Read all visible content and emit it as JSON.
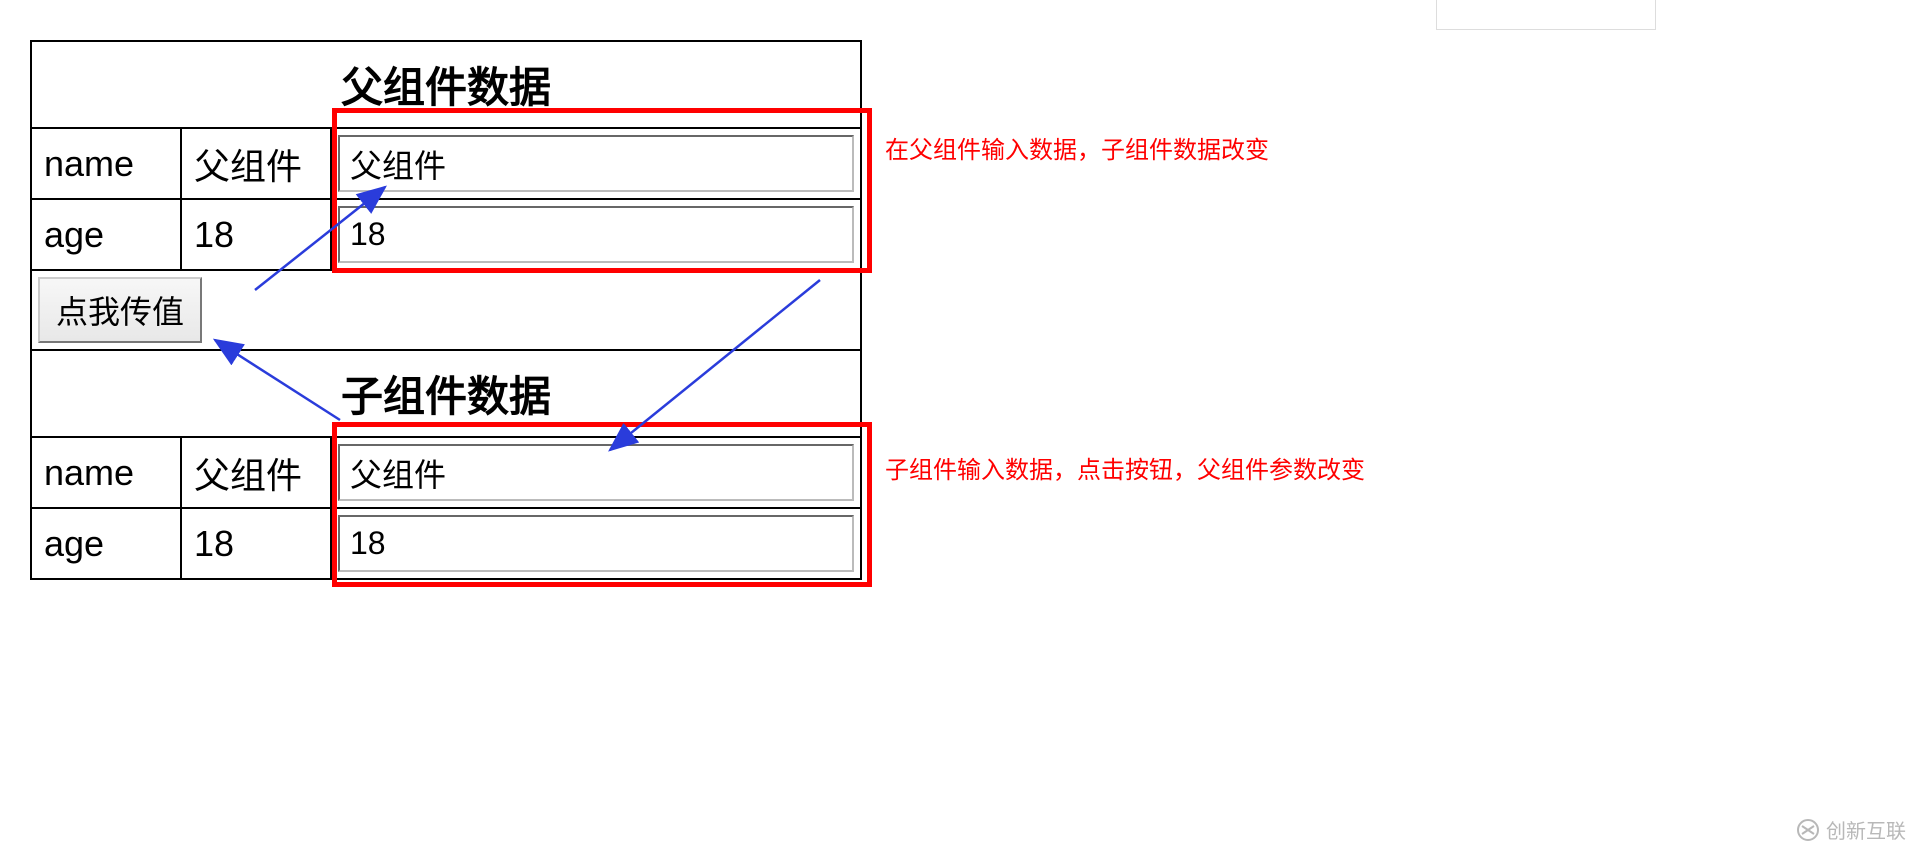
{
  "parent": {
    "header": "父组件数据",
    "row1_label": "name",
    "row1_value": "父组件",
    "row1_input": "父组件",
    "row2_label": "age",
    "row2_value": "18",
    "row2_input": "18"
  },
  "button": {
    "label": "点我传值"
  },
  "child": {
    "header": "子组件数据",
    "row1_label": "name",
    "row1_value": "父组件",
    "row1_input": "父组件",
    "row2_label": "age",
    "row2_value": "18",
    "row2_input": "18"
  },
  "notes": {
    "note1": "在父组件输入数据，子组件数据改变",
    "note2": "子组件输入数据，点击按钮，父组件参数改变"
  },
  "watermark": "创新互联"
}
